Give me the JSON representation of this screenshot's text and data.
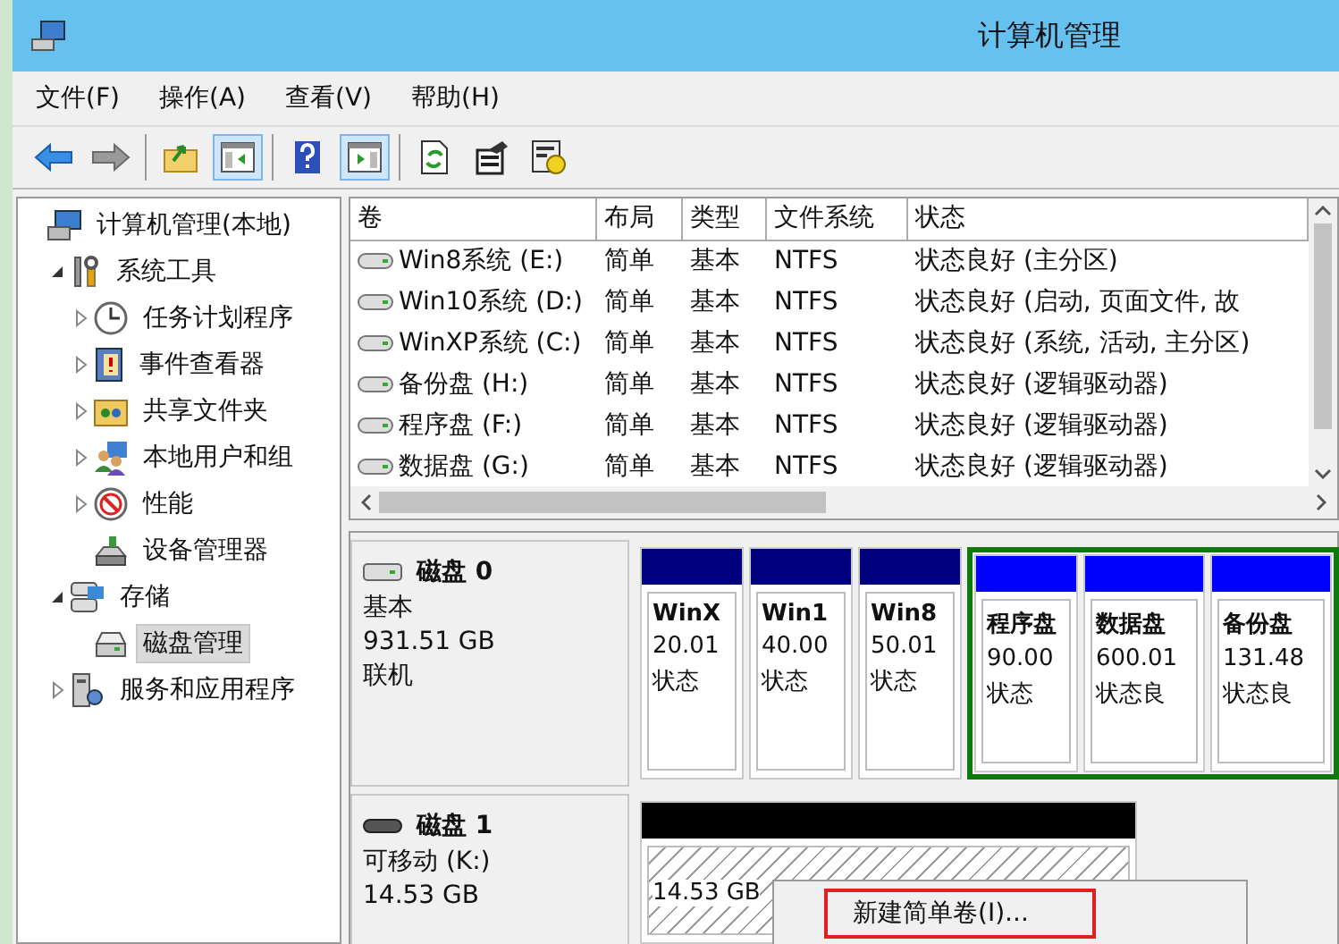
{
  "window": {
    "title": "计算机管理"
  },
  "menu": [
    "文件(F)",
    "操作(A)",
    "查看(V)",
    "帮助(H)"
  ],
  "toolbar": [
    [
      {
        "kind": "back",
        "pressed": false
      },
      {
        "kind": "forward",
        "pressed": false
      }
    ],
    [
      {
        "kind": "up",
        "pressed": false
      },
      {
        "kind": "tree",
        "pressed": true
      }
    ],
    [
      {
        "kind": "help",
        "pressed": false
      },
      {
        "kind": "pane",
        "pressed": true
      }
    ],
    [
      {
        "kind": "refresh",
        "pressed": false
      },
      {
        "kind": "properties",
        "pressed": false
      },
      {
        "kind": "export",
        "pressed": false
      }
    ]
  ],
  "tree": [
    {
      "label": "计算机管理(本地)",
      "kind": "computer",
      "selected": false,
      "children": [
        {
          "label": "系统工具",
          "kind": "tools",
          "expanded": true,
          "selected": false,
          "children": [
            {
              "label": "任务计划程序",
              "kind": "clock",
              "expanded": false,
              "selected": false
            },
            {
              "label": "事件查看器",
              "kind": "log",
              "expanded": false,
              "selected": false
            },
            {
              "label": "共享文件夹",
              "kind": "folder",
              "expanded": false,
              "selected": false
            },
            {
              "label": "本地用户和组",
              "kind": "users",
              "expanded": false,
              "selected": false
            },
            {
              "label": "性能",
              "kind": "gauge",
              "expanded": false,
              "selected": false
            },
            {
              "label": "设备管理器",
              "kind": "device",
              "selected": false
            }
          ]
        },
        {
          "label": "存储",
          "kind": "storage",
          "expanded": true,
          "selected": false,
          "children": [
            {
              "label": "磁盘管理",
              "kind": "disk",
              "selected": true
            }
          ]
        },
        {
          "label": "服务和应用程序",
          "kind": "services",
          "expanded": false,
          "selected": false
        }
      ]
    }
  ],
  "volumes": {
    "columns": [
      "卷",
      "布局",
      "类型",
      "文件系统",
      "状态"
    ],
    "rows": [
      {
        "cells": [
          "Win8系统 (E:)",
          "简单",
          "基本",
          "NTFS",
          "状态良好 (主分区)"
        ]
      },
      {
        "cells": [
          "Win10系统 (D:)",
          "简单",
          "基本",
          "NTFS",
          "状态良好 (启动, 页面文件, 故"
        ]
      },
      {
        "cells": [
          "WinXP系统 (C:)",
          "简单",
          "基本",
          "NTFS",
          "状态良好 (系统, 活动, 主分区)"
        ]
      },
      {
        "cells": [
          "备份盘 (H:)",
          "简单",
          "基本",
          "NTFS",
          "状态良好 (逻辑驱动器)"
        ]
      },
      {
        "cells": [
          "程序盘 (F:)",
          "简单",
          "基本",
          "NTFS",
          "状态良好 (逻辑驱动器)"
        ]
      },
      {
        "cells": [
          "数据盘 (G:)",
          "简单",
          "基本",
          "NTFS",
          "状态良好 (逻辑驱动器)"
        ]
      }
    ]
  },
  "disks": [
    {
      "name": "磁盘 0",
      "kind": "fixed",
      "info": [
        "基本",
        "931.51 GB",
        "联机"
      ],
      "partitions": [
        {
          "kind": "primary",
          "name": "WinX",
          "size": "20.01",
          "status": "状态"
        },
        {
          "kind": "primary",
          "name": "Win1",
          "size": "40.00",
          "status": "状态"
        },
        {
          "kind": "primary",
          "name": "Win8",
          "size": "50.01",
          "status": "状态"
        },
        {
          "kind": "extended",
          "children": [
            {
              "kind": "logical",
              "name": "程序盘",
              "size": "90.00",
              "status": "状态"
            },
            {
              "kind": "logical",
              "name": "数据盘",
              "size": "600.01",
              "status": "状态良"
            },
            {
              "kind": "logical",
              "name": "备份盘",
              "size": "131.48",
              "status": "状态良"
            }
          ]
        }
      ]
    },
    {
      "name": "磁盘 1",
      "kind": "removable",
      "info": [
        "可移动 (K:)",
        "14.53 GB"
      ],
      "partitions": [
        {
          "kind": "unallocated",
          "size": "14.53 GB"
        }
      ]
    }
  ],
  "context_menu": {
    "items": [
      {
        "label": "新建简单卷(I)...",
        "highlighted": true
      }
    ]
  }
}
